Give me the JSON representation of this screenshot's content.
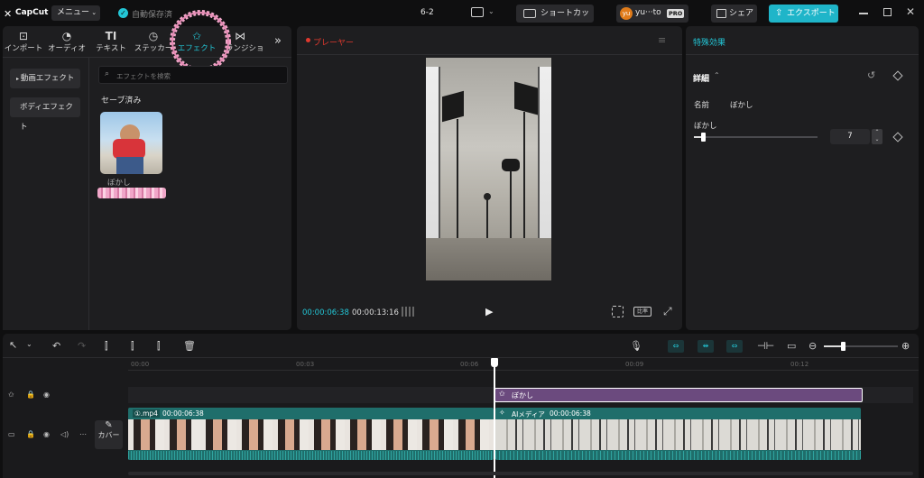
{
  "app": {
    "logo_text": "CapCut",
    "menu_label": "メニュー",
    "autosave": "自動保存済",
    "project_name": "6-2",
    "shortcut_label": "ショートカット",
    "user_name": "yu···to",
    "user_initials": "yu",
    "pro_badge": "PRO",
    "share_label": "シェア",
    "export_label": "エクスポート"
  },
  "media_tabs": [
    {
      "label": "インポート"
    },
    {
      "label": "オーディオ"
    },
    {
      "label": "テキスト"
    },
    {
      "label": "ステッカー"
    },
    {
      "label": "エフェクト"
    },
    {
      "label": "ランジション"
    }
  ],
  "effects_panel": {
    "side_items": [
      "動画エフェクト",
      "ボディエフェクト"
    ],
    "search_placeholder": "エフェクトを検索",
    "saved_title": "セーブ済み",
    "saved_item_label": "ぼかし"
  },
  "player": {
    "title": "プレーヤー",
    "current_time": "00:00:06:38",
    "total_time": "00:00:13:16",
    "ratio_label": "比率"
  },
  "details": {
    "panel_title": "特殊効果",
    "section_title": "詳細",
    "name_label": "名前",
    "name_value": "ぼかし",
    "blur_label": "ぼかし",
    "blur_value": "7"
  },
  "timeline": {
    "ruler_labels": [
      "00:00",
      "00:03",
      "00:06",
      "00:09",
      "00:12"
    ],
    "effect_clip_label": "ぼかし",
    "clip1_label": "①.mp4",
    "clip1_time": "00:00:06:38",
    "clip2_label": "AIメディア",
    "clip2_time": "00:00:06:38",
    "cover_label": "カバー"
  },
  "colors": {
    "accent": "#23c6d6",
    "effect_clip": "#6b4a7e",
    "video_clip": "#1f6e6b",
    "export_btn": "#1fb5c9",
    "record_dot": "#e0392e"
  }
}
